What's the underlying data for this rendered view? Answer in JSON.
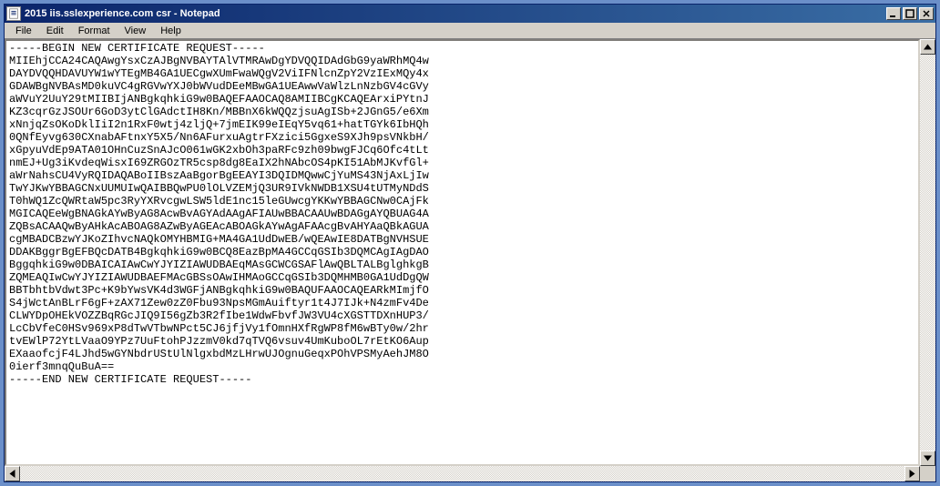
{
  "window": {
    "title": "2015 iis.sslexperience.com csr - Notepad",
    "icon_glyph": "📄"
  },
  "menu": {
    "file": "File",
    "edit": "Edit",
    "format": "Format",
    "view": "View",
    "help": "Help"
  },
  "content": "-----BEGIN NEW CERTIFICATE REQUEST-----\nMIIEhjCCA24CAQAwgYsxCzAJBgNVBAYTAlVTMRAwDgYDVQQIDAdGbG9yaWRhMQ4w\nDAYDVQQHDAVUYW1wYTEgMB4GA1UECgwXUmFwaWQgV2ViIFNlcnZpY2VzIExMQy4x\nGDAWBgNVBAsMD0kuVC4gRGVwYXJ0bWVudDEeMBwGA1UEAwwVaWlzLnNzbGV4cGVy\naWVuY2UuY29tMIIBIjANBgkqhkiG9w0BAQEFAAOCAQ8AMIIBCgKCAQEArxiPYtnJ\nKZ3cqrGzJSOUr6GoD3ytClGAdctIH8Kn/MBBnX6kWQQzjsuAgISb+2JGnG5/e6Xm\nxNnjqZsOKoDklIiI2n1RxF0wtj4zljQ+7jmEIK99eIEqY5vq61+hatTGYk6IbHQh\n0QNfEyvg630CXnabAFtnxY5X5/Nn6AFurxuAgtrFXzici5GgxeS9XJh9psVNkbH/\nxGpyuVdEp9ATA01OHnCuzSnAJcO061wGK2xbOh3paRFc9zh09bwgFJCq6Ofc4tLt\nnmEJ+Ug3iKvdeqWisxI69ZRGOzTR5csp8dg8EaIX2hNAbcOS4pKI51AbMJKvfGl+\naWrNahsCU4VyRQIDAQABoIIBszAaBgorBgEEAYI3DQIDMQwwCjYuMS43NjAxLjIw\nTwYJKwYBBAGCNxUUMUIwQAIBBQwPU0lOLVZEMjQ3UR9IVkNWDB1XSU4tUTMyNDdS\nT0hWQ1ZcQWRtaW5pc3RyYXRvcgwLSW5ldE1nc15leGUwcgYKKwYBBAGCNw0CAjFk\nMGICAQEeWgBNAGkAYwByAG8AcwBvAGYAdAAgAFIAUwBBACAAUwBDAGgAYQBUAG4A\nZQBsACAAQwByAHkAcABOAG8AZwByAGEAcABOAGkAYwAgAFAAcgBvAHYAaQBkAGUA\ncgMBADCBzwYJKoZIhvcNAQkOMYHBMIG+MA4GA1UdDwEB/wQEAwIE8DATBgNVHSUE\nDDAKBggrBgEFBQcDATB4BgkqhkiG9w0BCQ8EazBpMA4GCCqGSIb3DQMCAgIAgDAO\nBggqhkiG9w0DBAICAIAwCwYJYIZIAWUDBAEqMAsGCWCGSAFlAwQBLTALBglghkgB\nZQMEAQIwCwYJYIZIAWUDBAEFMAcGBSsOAwIHMAoGCCqGSIb3DQMHMB0GA1UdDgQW\nBBTbhtbVdwt3Pc+K9bYwsVK4d3WGFjANBgkqhkiG9w0BAQUFAAOCAQEARkMImjfO\nS4jWctAnBLrF6gF+zAX71Zew0zZ0Fbu93NpsMGmAuiftyr1t4J7IJk+N4zmFv4De\nCLWYDpOHEkVOZZBqRGcJIQ9I56gZb3R2fIbe1WdwFbvfJW3VU4cXGSTTDXnHUP3/\nLcCbVfeC0HSv969xP8dTwVTbwNPct5CJ6jfjVy1fOmnHXfRgWP8fM6wBTy0w/2hr\ntvEWlP72YtLVaaO9YPz7UuFtohPJzzmV0kd7qTVQ6vsuv4UmKuboOL7rEtKO6Aup\nEXaaofcjF4LJhd5wGYNbdrUStUlNlgxbdMzLHrwUJOgnuGeqxPOhVPSMyAehJM8O\n0ierf3mnqQuBuA==\n-----END NEW CERTIFICATE REQUEST-----"
}
